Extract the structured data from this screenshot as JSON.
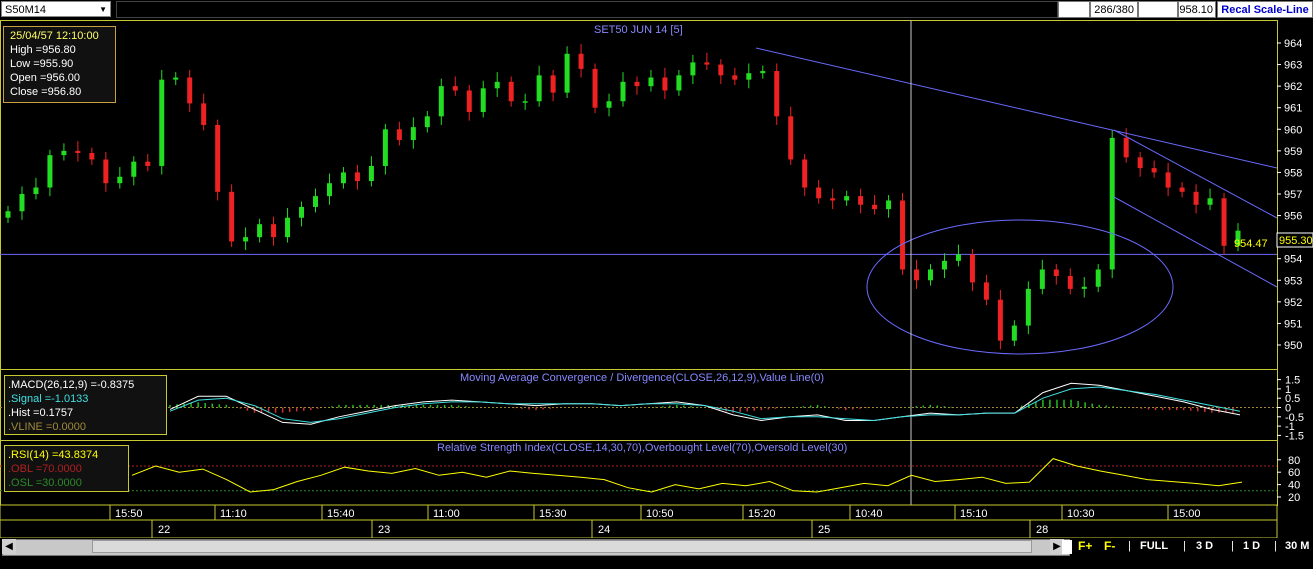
{
  "toolbar": {
    "symbol": "S50M14",
    "counter": "286/380",
    "last_price": "958.10",
    "recal_label": "Recal Scale-Line"
  },
  "info": {
    "datetime": "25/04/57 12:10:00",
    "high": "High  =956.80",
    "low": "Low   =955.90",
    "open": "Open  =956.00",
    "close": "Close =956.80"
  },
  "chart_data": [
    {
      "type": "candlestick",
      "title": "SET50 JUN 14   [5]",
      "yticks": [
        "964",
        "963",
        "962",
        "961",
        "960",
        "959",
        "958",
        "957",
        "956",
        "955",
        "954",
        "953",
        "952",
        "951",
        "950"
      ],
      "ylim": [
        949.5,
        964.5
      ],
      "current_price_label": "955.30",
      "low_annotation": "954.47",
      "horizontal_line": 954.2,
      "close_approx": [
        956.2,
        957.0,
        957.3,
        958.8,
        959.0,
        958.9,
        958.6,
        957.5,
        957.8,
        958.5,
        958.3,
        962.3,
        962.4,
        961.2,
        960.2,
        957.1,
        954.8,
        955.0,
        955.6,
        955.0,
        955.9,
        956.4,
        956.9,
        957.5,
        958.0,
        957.6,
        958.3,
        960.0,
        959.5,
        960.1,
        960.6,
        962.0,
        961.8,
        960.8,
        961.9,
        962.2,
        961.3,
        961.3,
        962.5,
        961.7,
        963.5,
        962.8,
        961.0,
        961.3,
        962.2,
        962.0,
        962.4,
        961.8,
        962.5,
        963.1,
        963.0,
        962.5,
        962.3,
        962.6,
        962.7,
        960.6,
        958.6,
        957.3,
        956.8,
        956.7,
        956.9,
        956.5,
        956.3,
        956.7,
        953.5,
        953.0,
        953.5,
        953.9,
        954.2,
        952.9,
        952.1,
        950.2,
        950.9,
        952.6,
        953.5,
        953.2,
        952.6,
        952.7,
        953.5,
        959.6,
        958.7,
        958.2,
        958.0,
        957.3,
        957.1,
        956.5,
        956.8,
        954.6,
        955.3
      ],
      "annotations": [
        "trend line",
        "ellipse"
      ]
    },
    {
      "type": "line",
      "title": "Moving Average Convergence / Divergence(CLOSE,26,12,9),Value Line(0)",
      "yticks": [
        "1.5",
        "1",
        "0.5",
        "0",
        "-0.5",
        "-1",
        "-1.5"
      ],
      "ylim": [
        -1.8,
        1.8
      ],
      "legend": {
        "macd": ".MACD(26,12,9)   =-0.8375",
        "signal": ".Signal  =-1.0133",
        "hist": ".Hist  =0.1757",
        "vline": ".VLINE   =0.0000"
      },
      "series": [
        {
          "name": "MACD",
          "color": "#ffffff",
          "values": [
            -0.1,
            0.6,
            0.6,
            -0.1,
            -0.8,
            -0.9,
            -0.5,
            -0.2,
            0.1,
            0.3,
            0.4,
            0.3,
            0.2,
            0.1,
            0.2,
            0.2,
            0.1,
            0.2,
            0.3,
            0.1,
            -0.4,
            -0.7,
            -0.5,
            -0.4,
            -0.7,
            -0.7,
            -0.5,
            -0.3,
            -0.4,
            -0.3,
            -0.3,
            0.8,
            1.3,
            1.2,
            0.9,
            0.6,
            0.3,
            -0.1,
            -0.4
          ]
        },
        {
          "name": "Signal",
          "color": "#40e0e0",
          "values": [
            -0.2,
            0.4,
            0.5,
            0.1,
            -0.6,
            -0.8,
            -0.6,
            -0.3,
            0.0,
            0.2,
            0.3,
            0.3,
            0.2,
            0.2,
            0.2,
            0.2,
            0.1,
            0.2,
            0.2,
            0.1,
            -0.2,
            -0.6,
            -0.5,
            -0.5,
            -0.6,
            -0.7,
            -0.5,
            -0.4,
            -0.4,
            -0.3,
            -0.3,
            0.5,
            1.0,
            1.1,
            0.9,
            0.7,
            0.4,
            0.1,
            -0.2
          ]
        }
      ]
    },
    {
      "type": "line",
      "title": "Relative Strength Index(CLOSE,14,30,70),Overbought Level(70),Oversold Level(30)",
      "yticks": [
        "80",
        "60",
        "40",
        "20"
      ],
      "ylim": [
        5,
        95
      ],
      "legend": {
        "rsi": ".RSI(14)    =43.8374",
        "obl": ".OBL   =70.0000",
        "osl": ".OSL   =30.0000"
      },
      "overbought": 70,
      "oversold": 30,
      "series": [
        {
          "name": "RSI",
          "color": "#ffff00",
          "values": [
            55,
            70,
            60,
            65,
            48,
            28,
            32,
            45,
            55,
            68,
            62,
            58,
            66,
            55,
            60,
            52,
            62,
            58,
            55,
            52,
            48,
            35,
            28,
            40,
            33,
            42,
            38,
            45,
            30,
            28,
            35,
            42,
            38,
            55,
            45,
            48,
            52,
            42,
            44,
            82,
            70,
            62,
            55,
            48,
            45,
            42,
            38,
            44
          ]
        }
      ]
    }
  ],
  "time_axis": {
    "times": [
      "15:50",
      "11:10",
      "15:40",
      "11:00",
      "15:30",
      "10:50",
      "15:20",
      "10:40",
      "15:10",
      "10:30",
      "15:00"
    ],
    "dates": [
      "22",
      "23",
      "24",
      "25",
      "28"
    ]
  },
  "bottom": {
    "zoom_in": "F+",
    "zoom_out": "F-",
    "full": "FULL",
    "d3": "3 D",
    "d1": "1 D",
    "m30": "30 M"
  }
}
